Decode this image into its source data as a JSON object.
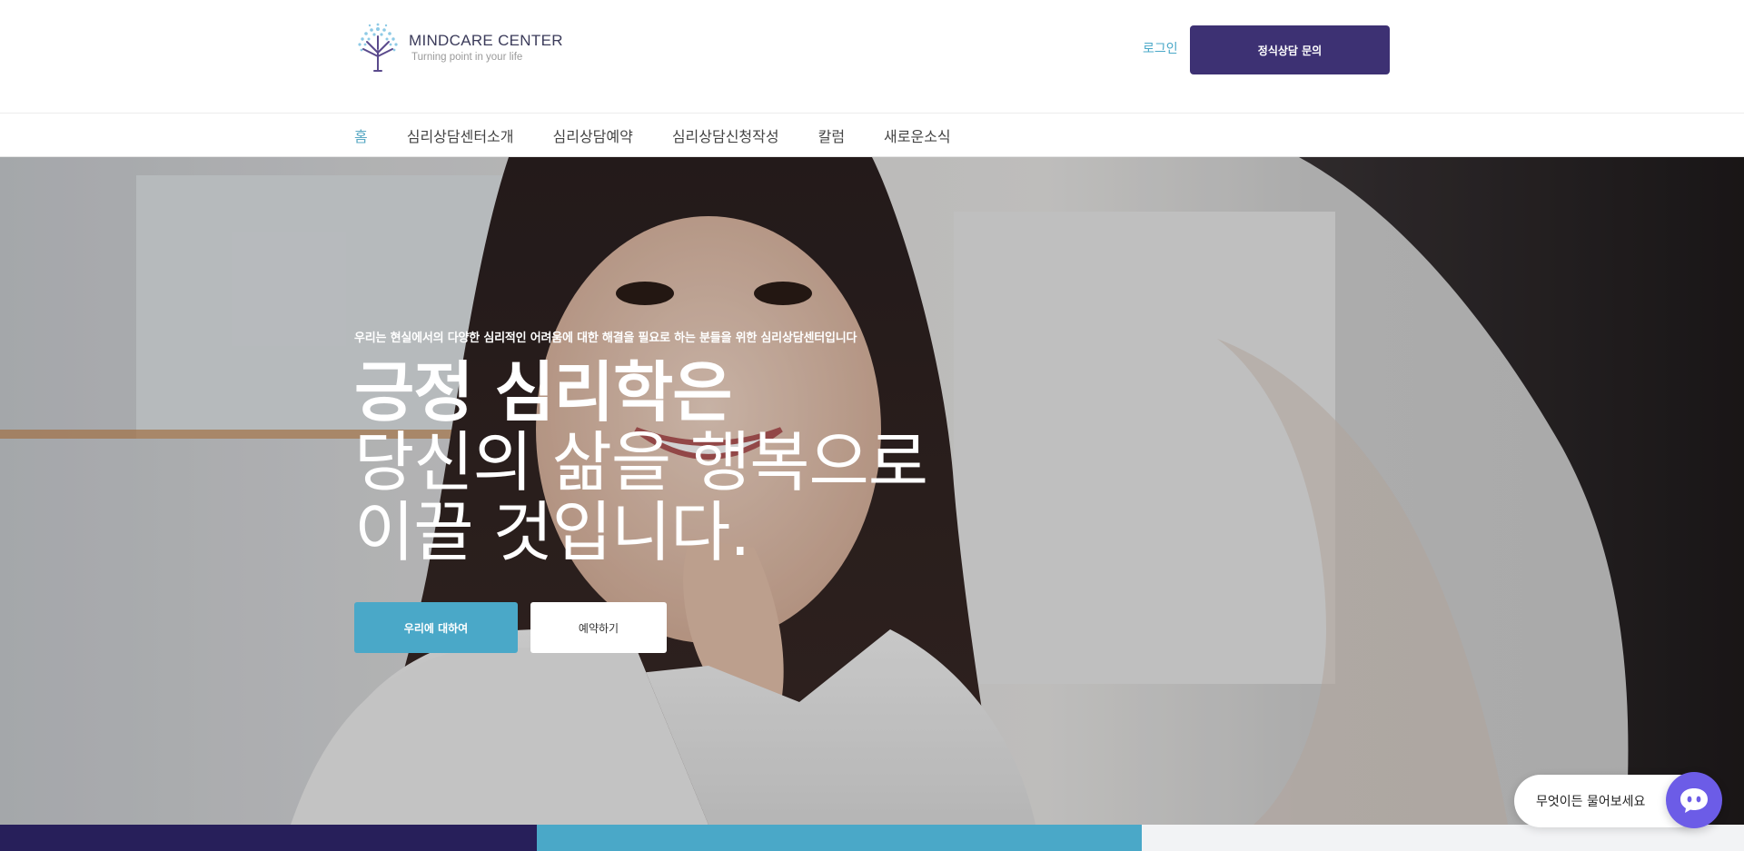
{
  "header": {
    "logo_name": "MINDCARE CENTER",
    "logo_tagline": "Turning point in your life",
    "login_label": "로그인",
    "cta_label": "정식상담 문의"
  },
  "nav": {
    "items": [
      {
        "label": "홈",
        "active": true
      },
      {
        "label": "심리상담센터소개",
        "active": false
      },
      {
        "label": "심리상담예약",
        "active": false
      },
      {
        "label": "심리상담신청작성",
        "active": false
      },
      {
        "label": "칼럼",
        "active": false
      },
      {
        "label": "새로운소식",
        "active": false
      }
    ]
  },
  "hero": {
    "subtitle": "우리는 현실에서의 다양한 심리적인 어려움에 대한 해결을 필요로 하는 분들을 위한 심리상담센터입니다",
    "title_bold": "긍정 심리학은",
    "title_line2": "당신의 삶을 행복으로",
    "title_line3": "이끌 것입니다.",
    "primary_button": "우리에 대하여",
    "secondary_button": "예약하기"
  },
  "chat": {
    "prompt": "무엇이든 물어보세요"
  },
  "colors": {
    "brand_purple": "#3d3173",
    "accent_blue": "#4aa8c8",
    "strip_dark": "#271f5a",
    "chat_purple": "#6c5ce7"
  },
  "icons": {
    "logo": "tree-logo-icon",
    "chat": "chat-face-icon"
  }
}
